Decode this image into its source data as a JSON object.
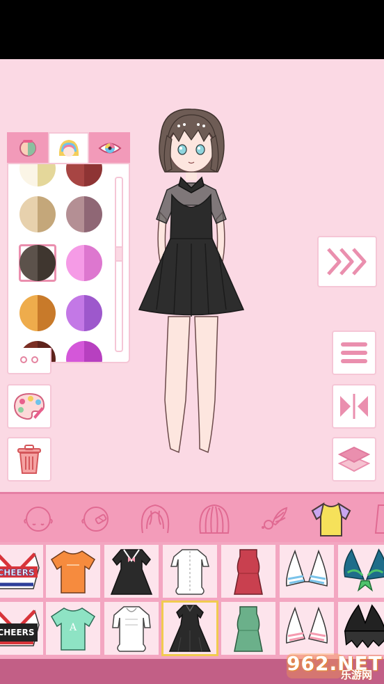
{
  "panel": {
    "tabs": [
      {
        "name": "skin-tone-tab",
        "active": false
      },
      {
        "name": "hair-color-tab",
        "active": true
      },
      {
        "name": "eye-color-tab",
        "active": false
      }
    ],
    "swatches": [
      {
        "left": "#fbf5e6",
        "right": "#e4d79a"
      },
      {
        "left": "#a74543",
        "right": "#8e3434"
      },
      {
        "left": "#e7d1ad",
        "right": "#c4a77a"
      },
      {
        "left": "#b48f94",
        "right": "#8f6775"
      },
      {
        "left": "#5c524b",
        "right": "#3f362f"
      },
      {
        "left": "#f59be6",
        "right": "#dd77cf"
      },
      {
        "left": "#eeac4c",
        "right": "#c87a2a"
      },
      {
        "left": "#c378e6",
        "right": "#9d58cc"
      },
      {
        "left": "#7b2f24",
        "right": "#5e231c"
      },
      {
        "left": "#d457d9",
        "right": "#b740c0"
      }
    ],
    "selected_index": 4
  },
  "side_buttons": [
    "next-button",
    "menu-button",
    "flip-button",
    "layers-button",
    "palette-button",
    "delete-button"
  ],
  "categories": [
    "face-icon",
    "face-blush-icon",
    "front-hair-icon",
    "back-hair-icon",
    "accessory-icon",
    "top-clothes-icon",
    "dress-icon"
  ],
  "items_row1": [
    "cheer-top-red",
    "orange-tshirt",
    "sailor-dress",
    "white-blouse",
    "red-dress",
    "blue-bikini",
    "green-bikini"
  ],
  "items_row2": [
    "cheer-top-black",
    "mint-tshirt",
    "white-frill-blouse",
    "black-dress",
    "green-dress",
    "pink-bikini",
    "black-fringe-top"
  ],
  "item_texts": {
    "cheers": "CHEERS",
    "letter_a": "A"
  },
  "selected_item": "black-dress",
  "watermark": {
    "main": "962.NET",
    "sub": "乐游网"
  }
}
